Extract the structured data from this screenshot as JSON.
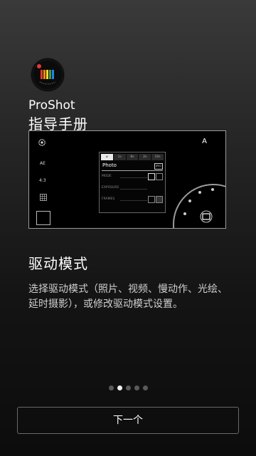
{
  "app": {
    "name": "ProShot",
    "guide_title": "指导手册",
    "icon": "proshot-app-icon"
  },
  "preview": {
    "left_labels": {
      "ae": "AE",
      "ratio": "4:3"
    },
    "mode": "A",
    "tabs": [
      "⌀",
      "1s",
      "8s",
      "2s",
      "10s"
    ],
    "active_tab_index": 0,
    "photo_label": "Photo",
    "photo_badge": "JPEG",
    "rows": [
      {
        "label": "MODE"
      },
      {
        "label": "EXPOSURE"
      },
      {
        "label": "FRAMES"
      }
    ],
    "dial_mode": "A"
  },
  "section": {
    "title": "驱动模式",
    "description": "选择驱动模式（照片、视频、慢动作、光绘、延时摄影），或修改驱动模式设置。"
  },
  "pagination": {
    "total": 5,
    "active_index": 1
  },
  "next_button": {
    "label": "下一个"
  },
  "colors": {
    "accent": "#e53935",
    "background": "#1a1a1a",
    "dot_active": "#f0f0f0",
    "dot_inactive": "#5a5a5a"
  }
}
